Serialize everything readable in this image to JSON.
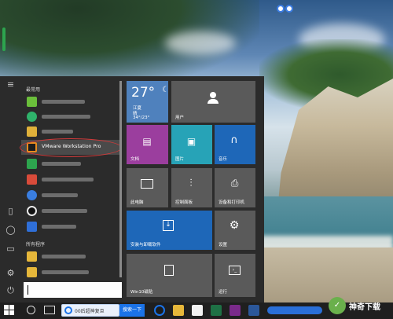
{
  "start_menu": {
    "most_used_header": "最常用",
    "selected_app_label": "VMware Workstation Pro",
    "all_programs_header": "所有程序",
    "search_input_value": ""
  },
  "tiles": {
    "weather": {
      "temp": "27°",
      "city": "江夏",
      "desc": "晴",
      "range": "34°/23°"
    },
    "user": {
      "label": "用户"
    },
    "documents": {
      "label": "文档"
    },
    "pictures": {
      "label": "图片"
    },
    "music": {
      "label": "音乐"
    },
    "this_pc": {
      "label": "此电脑"
    },
    "control_panel": {
      "label": "控制面板"
    },
    "devices_printers": {
      "label": "设备和打印机"
    },
    "install_remove": {
      "label": "安装与卸载软件"
    },
    "settings": {
      "label": "设置"
    },
    "win10_tiles": {
      "label": "Win10磁贴"
    },
    "run": {
      "label": "运行"
    }
  },
  "taskbar": {
    "browser_chip_text": "00后超神复旦",
    "search_button": "搜索一下"
  },
  "watermark": {
    "text": "神奇下载"
  },
  "colors": {
    "start_bg": "#2b2b2b",
    "weather_tile": "#4f81bd",
    "purple_tile": "#9b3e9e",
    "teal_tile": "#27a3b7",
    "blue_tile": "#1e67b8",
    "accent_blue": "#1b73e8"
  }
}
